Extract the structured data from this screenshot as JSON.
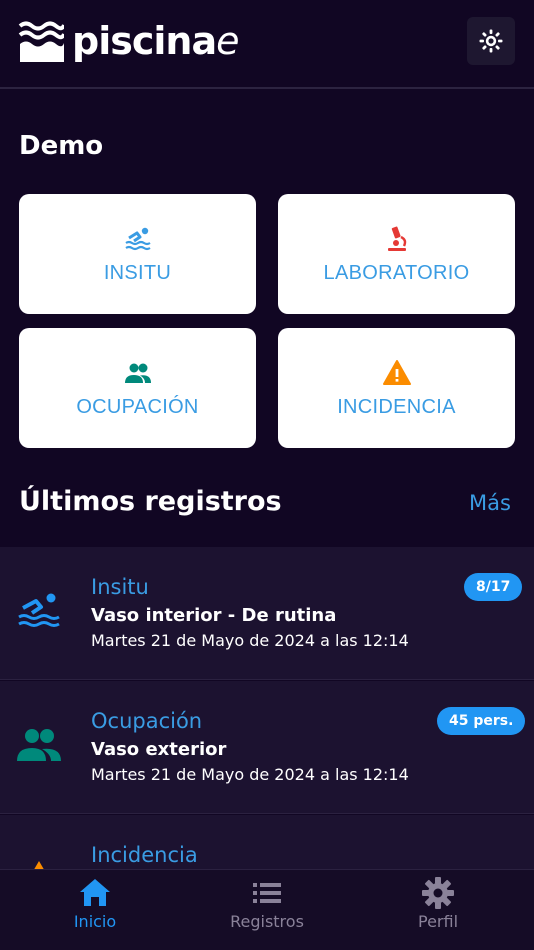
{
  "header": {
    "logo_text": "piscina",
    "logo_suffix": "e",
    "settings_icon": "gear-sun-icon"
  },
  "section": {
    "title": "Demo"
  },
  "cards": [
    {
      "label": "INSITU",
      "icon": "swimmer-icon",
      "color": "#3a9ce3"
    },
    {
      "label": "LABORATORIO",
      "icon": "microscope-icon",
      "color": "#e53935"
    },
    {
      "label": "OCUPACIÓN",
      "icon": "people-icon",
      "color": "#00897b"
    },
    {
      "label": "INCIDENCIA",
      "icon": "warning-icon",
      "color": "#fb8c00"
    }
  ],
  "recent": {
    "title": "Últimos registros",
    "more_label": "Más",
    "items": [
      {
        "type": "Insitu",
        "title": "Vaso interior - De rutina",
        "date": "Martes 21 de Mayo de 2024 a las 12:14",
        "badge": "8/17",
        "icon": "swimmer-icon"
      },
      {
        "type": "Ocupación",
        "title": "Vaso exterior",
        "date": "Martes 21 de Mayo de 2024 a las 12:14",
        "badge": "45 pers.",
        "icon": "people-icon"
      },
      {
        "type": "Incidencia",
        "title": "",
        "date": "",
        "badge": "",
        "icon": "warning-icon"
      }
    ]
  },
  "tabs": [
    {
      "label": "Inicio",
      "icon": "home-icon",
      "active": true
    },
    {
      "label": "Registros",
      "icon": "list-icon",
      "active": false
    },
    {
      "label": "Perfil",
      "icon": "gear-icon",
      "active": false
    }
  ],
  "colors": {
    "background": "#110623",
    "accent": "#3a9ce3",
    "badge": "#2196f3",
    "tab_inactive": "#8a8299"
  }
}
